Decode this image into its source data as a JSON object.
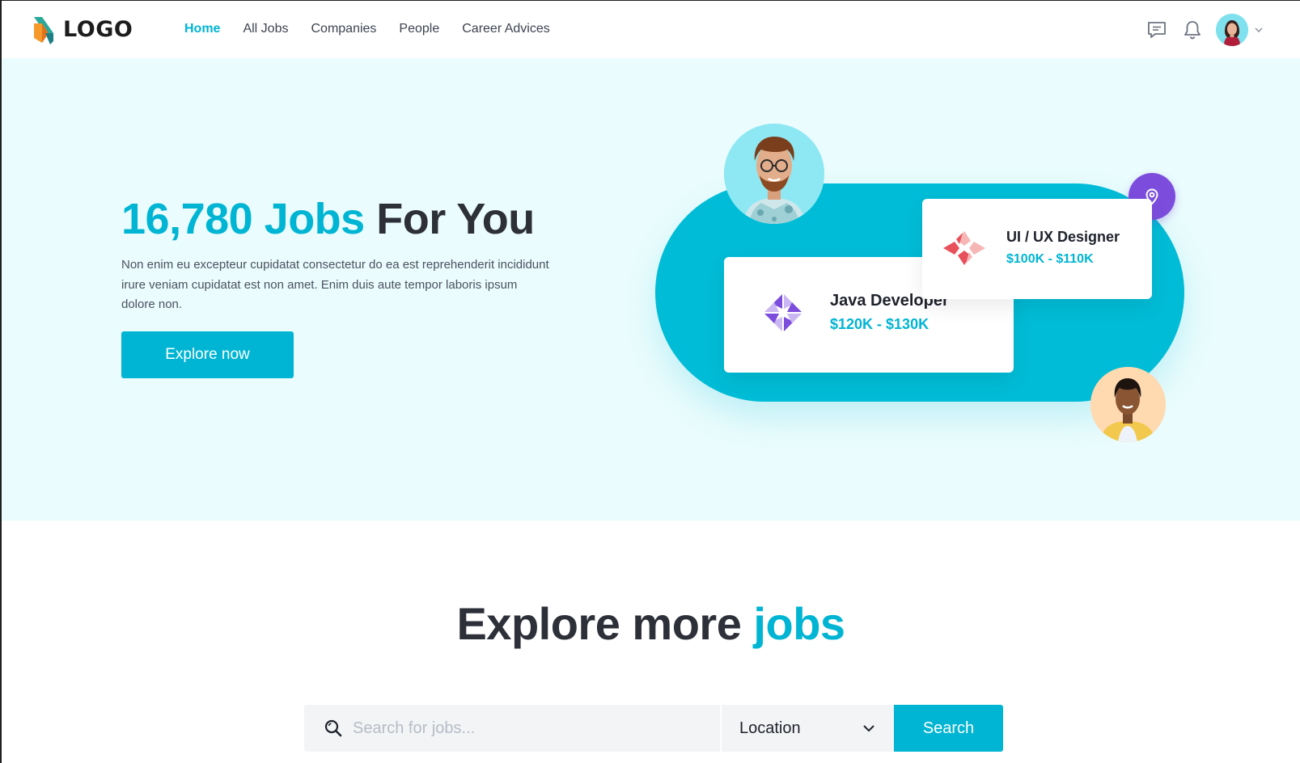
{
  "header": {
    "logo_text": "LOGO",
    "nav": [
      {
        "label": "Home",
        "active": true
      },
      {
        "label": "All Jobs",
        "active": false
      },
      {
        "label": "Companies",
        "active": false
      },
      {
        "label": "People",
        "active": false
      },
      {
        "label": "Career Advices",
        "active": false
      }
    ],
    "icons": [
      "message-icon",
      "bell-icon"
    ]
  },
  "hero": {
    "title_accent": "16,780 Jobs",
    "title_dark": "For You",
    "description": "Non enim eu excepteur cupidatat consectetur do ea est reprehenderit incididunt irure veniam cupidatat est non amet. Enim duis aute tempor laboris ipsum dolore non.",
    "cta_label": "Explore now",
    "cards": [
      {
        "title": "Java Developer",
        "salary": "$120K - $130K"
      },
      {
        "title": "UI / UX Designer",
        "salary": "$100K - $110K"
      }
    ]
  },
  "explore": {
    "title_dark": "Explore more",
    "title_accent": "jobs",
    "search_placeholder": "Search for jobs...",
    "location_label": "Location",
    "search_button": "Search"
  },
  "colors": {
    "accent": "#00b5d3",
    "hero_bg": "#eafcfd",
    "pin": "#7c4ddd",
    "dark_text": "#2d3039"
  }
}
